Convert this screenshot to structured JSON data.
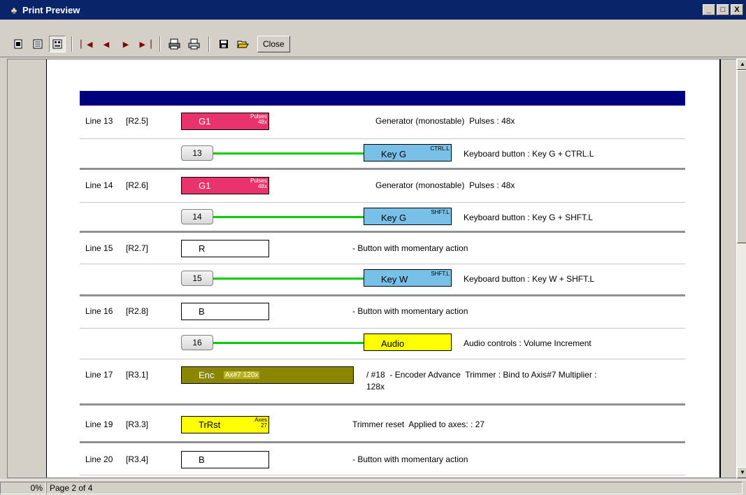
{
  "window": {
    "title": "Print Preview",
    "minimize": "_",
    "maximize": "□",
    "close": "X"
  },
  "toolbar": {
    "buttons": [
      "one-page-icon",
      "two-page-icon",
      "multi-page-icon",
      "first-page-icon",
      "prev-page-icon",
      "next-page-icon",
      "last-page-icon",
      "print-setup-icon",
      "print-icon",
      "save-icon",
      "open-icon"
    ],
    "close_label": "Close"
  },
  "status": {
    "zoom": "0%",
    "page": "Page 2 of 4"
  },
  "report": {
    "rows": [
      {
        "line": "Line 13",
        "ref": "[R2.5]",
        "block": {
          "label": "G1",
          "sup1": "Pulses",
          "sup2": "48x",
          "color": "#e8336e"
        },
        "desc": "Generator (monostable)  Pulses : 48x",
        "output": {
          "num": "13",
          "label": "Key G",
          "sup": "CTRL.L",
          "color": "#79c0e8",
          "desc": "Keyboard button : Key G + CTRL.L"
        }
      },
      {
        "line": "Line 14",
        "ref": "[R2.6]",
        "block": {
          "label": "G1",
          "sup1": "Pulses",
          "sup2": "48x",
          "color": "#e8336e"
        },
        "desc": "Generator (monostable)  Pulses : 48x",
        "output": {
          "num": "14",
          "label": "Key G",
          "sup": "SHFT.L",
          "color": "#79c0e8",
          "desc": "Keyboard button : Key G + SHFT.L"
        }
      },
      {
        "line": "Line 15",
        "ref": "[R2.7]",
        "block": {
          "label": "R",
          "color": "#ffffff"
        },
        "desc": "- Button with momentary action",
        "output": {
          "num": "15",
          "label": "Key W",
          "sup": "SHFT.L",
          "color": "#79c0e8",
          "desc": "Keyboard button : Key W + SHFT.L"
        }
      },
      {
        "line": "Line 16",
        "ref": "[R2.8]",
        "block": {
          "label": "B",
          "color": "#ffffff"
        },
        "desc": "- Button with momentary action",
        "output": {
          "num": "16",
          "label": "Audio",
          "color": "#ffff00",
          "desc": "Audio controls : Volume Increment"
        }
      },
      {
        "line": "Line 17",
        "ref": "[R3.1]",
        "block": {
          "label": "Enc",
          "tag": "Ax#7 120x",
          "color": "#8b8600"
        },
        "desc": "/ #18  - Encoder Advance  Trimmer : Bind to Axis#7 Multiplier :",
        "desc2": "128x"
      },
      {
        "line": "Line 19",
        "ref": "[R3.3]",
        "block": {
          "label": "TrRst",
          "sup1": "Axes",
          "sup2": "27",
          "color": "#ffff00"
        },
        "desc": "Trimmer reset  Applied to axes: : 27"
      },
      {
        "line": "Line 20",
        "ref": "[R3.4]",
        "block": {
          "label": "B",
          "color": "#ffffff"
        },
        "desc": "- Button with momentary action"
      }
    ]
  }
}
